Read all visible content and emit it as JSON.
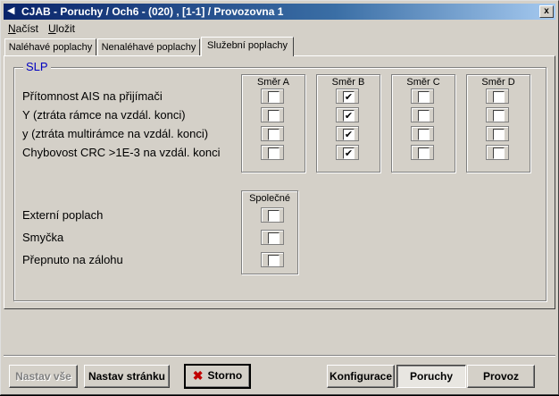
{
  "window": {
    "title": "CJAB - Poruchy / Och6 - (020) , [1-1] / Provozovna 1",
    "close_label": "x"
  },
  "menu": [
    {
      "label": "Načíst",
      "hotkey": "N"
    },
    {
      "label": "Uložit",
      "hotkey": "U"
    }
  ],
  "tabs": [
    {
      "label": "Naléhavé poplachy"
    },
    {
      "label": "Nenaléhavé poplachy"
    },
    {
      "label": "Služební poplachy",
      "active": true
    }
  ],
  "group": {
    "title": "SLP",
    "columns": [
      "Směr A",
      "Směr B",
      "Směr C",
      "Směr D"
    ],
    "rows": [
      {
        "label": "Přítomnost AIS na přijímači",
        "checked": [
          false,
          true,
          false,
          false
        ]
      },
      {
        "label": "Y (ztráta rámce na vzdál. konci)",
        "checked": [
          false,
          true,
          false,
          false
        ]
      },
      {
        "label": "y (ztráta multirámce na vzdál. konci)",
        "checked": [
          false,
          true,
          false,
          false
        ]
      },
      {
        "label": "Chybovost CRC >1E-3 na vzdál. konci",
        "checked": [
          false,
          true,
          false,
          false
        ]
      }
    ],
    "common_header": "Společné",
    "common_rows": [
      {
        "label": "Externí poplach",
        "checked": false
      },
      {
        "label": "Smyčka",
        "checked": false
      },
      {
        "label": "Přepnuto na zálohu",
        "checked": false
      }
    ]
  },
  "buttons": {
    "set_all": "Nastav vše",
    "set_page": "Nastav stránku",
    "cancel": "Storno",
    "config": "Konfigurace",
    "faults": "Poruchy",
    "operation": "Provoz"
  },
  "colors": {
    "title_start": "#0a246a",
    "title_end": "#a6caf0",
    "group_title": "#0000c0",
    "cancel_icon": "#c00000"
  },
  "icons": {
    "app": "app-icon",
    "close": "close-icon",
    "cancel": "red-x-icon",
    "check": "checkmark-icon"
  }
}
